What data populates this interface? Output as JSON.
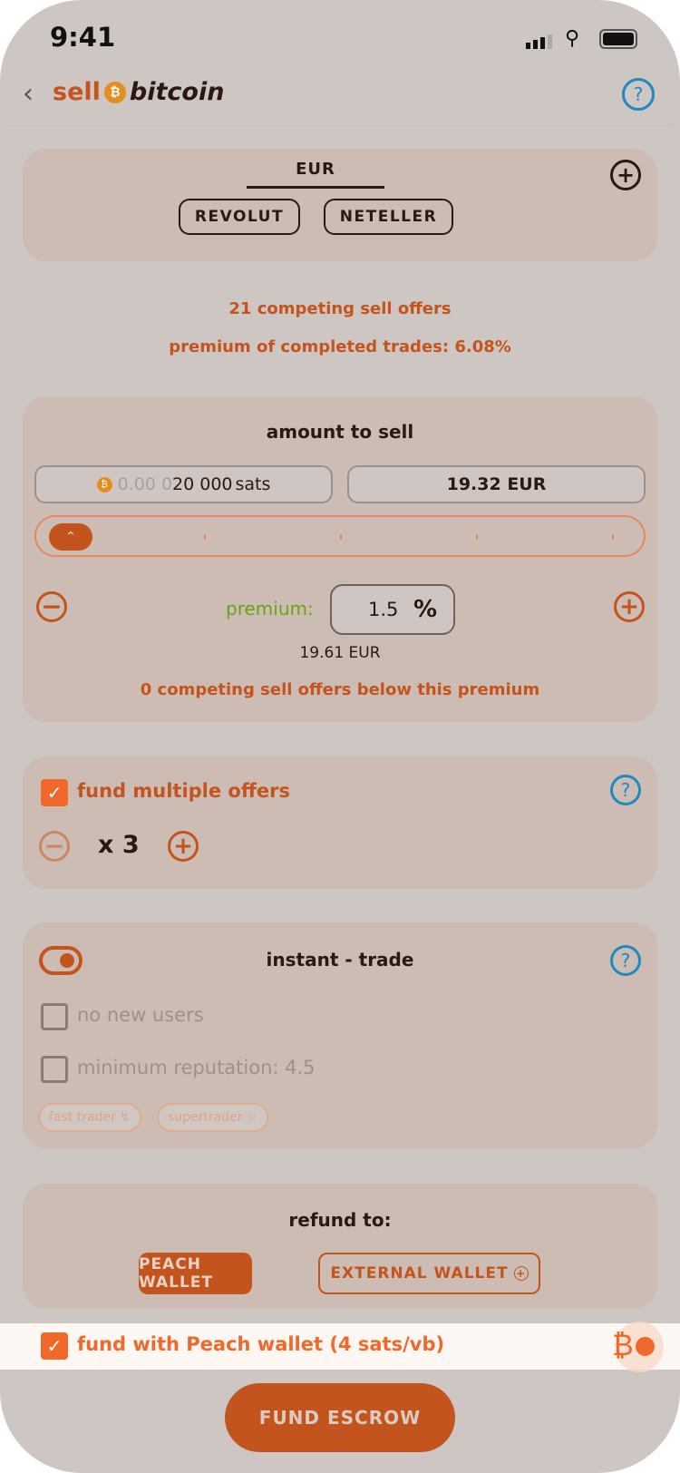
{
  "status_bar": {
    "time": "9:41"
  },
  "header": {
    "title_sell": "sell",
    "title_bitcoin": "bitcoin",
    "help_icon": "question-circle-icon"
  },
  "payment": {
    "currency_tab": "EUR",
    "methods": [
      "REVOLUT",
      "NETELLER"
    ]
  },
  "market": {
    "competing": "21 competing sell offers",
    "premium_completed": "premium of completed trades: 6.08%"
  },
  "amount": {
    "title": "amount to sell",
    "btc_prefix": "0.00 0",
    "sats_value": "20 000",
    "sats_unit": "sats",
    "fiat_value": "19.32  EUR",
    "slider_value": 0,
    "premium_label": "premium:",
    "premium_value": "1.5",
    "premium_unit": "%",
    "price_with_premium": "19.61 EUR",
    "competing_below": "0 competing sell offers below this premium"
  },
  "multiple": {
    "label": "fund multiple offers",
    "checked": true,
    "count": "x 3"
  },
  "instant": {
    "title": "instant - trade",
    "enabled": true,
    "no_new_users": "no new users",
    "min_rep": "minimum reputation: 4.5",
    "tags": [
      "fast trader",
      "supertrader"
    ]
  },
  "refund": {
    "title": "refund to:",
    "peach": "PEACH WALLET",
    "external": "EXTERNAL WALLET"
  },
  "fund_with": {
    "label": "fund with Peach wallet (4 sats/vb)",
    "checked": true
  },
  "cta": {
    "label": "FUND ESCROW"
  },
  "colors": {
    "accent": "#c4541d",
    "help": "#1f8ac0",
    "premium": "#65a519"
  }
}
